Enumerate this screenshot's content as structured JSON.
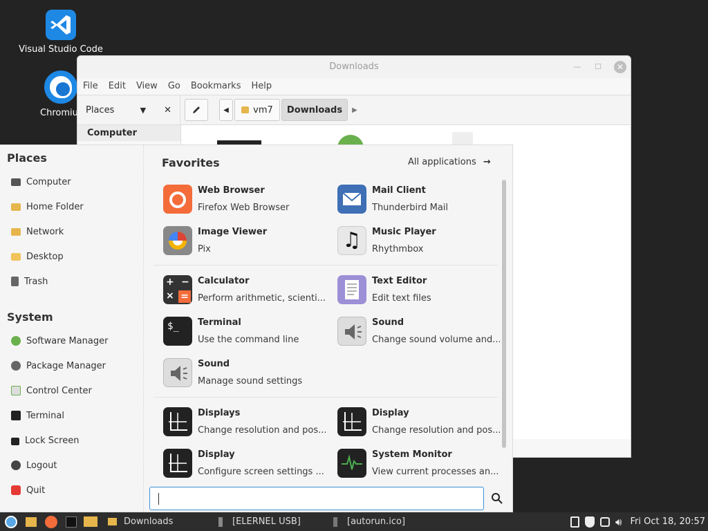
{
  "desktop": {
    "icons": [
      {
        "label": "Visual Studio Code",
        "icon": "vscode-icon"
      },
      {
        "label": "Chromium",
        "icon": "chromium-icon"
      }
    ]
  },
  "window": {
    "title": "Downloads",
    "menu": [
      "File",
      "Edit",
      "View",
      "Go",
      "Bookmarks",
      "Help"
    ],
    "places_label": "Places",
    "path": [
      "vm7",
      "Downloads"
    ],
    "sidebar_heading": "Computer"
  },
  "menu": {
    "places_title": "Places",
    "places": [
      "Computer",
      "Home Folder",
      "Network",
      "Desktop",
      "Trash"
    ],
    "system_title": "System",
    "system": [
      "Software Manager",
      "Package Manager",
      "Control Center",
      "Terminal",
      "Lock Screen",
      "Logout",
      "Quit"
    ],
    "favorites_title": "Favorites",
    "all_apps": "All applications",
    "apps": [
      {
        "name": "Web Browser",
        "desc": "Firefox Web Browser"
      },
      {
        "name": "Mail Client",
        "desc": "Thunderbird Mail"
      },
      {
        "name": "Image Viewer",
        "desc": "Pix"
      },
      {
        "name": "Music Player",
        "desc": "Rhythmbox"
      },
      {
        "name": "Calculator",
        "desc": "Perform arithmetic, scienti..."
      },
      {
        "name": "Text Editor",
        "desc": "Edit text files"
      },
      {
        "name": "Terminal",
        "desc": "Use the command line"
      },
      {
        "name": "Sound",
        "desc": "Change sound volume and..."
      },
      {
        "name": "Sound",
        "desc": "Manage sound settings"
      },
      {
        "name": "Displays",
        "desc": "Change resolution and pos..."
      },
      {
        "name": "Display",
        "desc": "Change resolution and pos..."
      },
      {
        "name": "Display",
        "desc": "Configure screen settings ..."
      },
      {
        "name": "System Monitor",
        "desc": "View current processes an..."
      }
    ],
    "search_value": ""
  },
  "taskbar": {
    "windows": [
      "Downloads",
      "[ELERNEL USB]",
      "[autorun.ico]"
    ],
    "clock": "Fri Oct 18, 20:57"
  },
  "colors": {
    "accent": "#3b8fd9",
    "firefox": "#f36c3a",
    "monitor_green": "#4caf50"
  }
}
